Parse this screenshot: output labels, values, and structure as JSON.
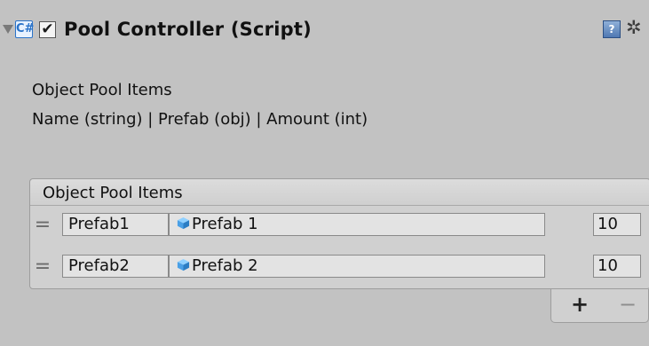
{
  "component": {
    "title": "Pool Controller (Script)",
    "script_icon": "C#",
    "enabled_checkmark": "✔",
    "help_icon_label": "?",
    "gear_icon_glyph": "✲"
  },
  "info": {
    "title": "Object Pool Items",
    "columns": "Name (string) | Prefab (obj) | Amount (int)"
  },
  "list": {
    "header": "Object Pool Items",
    "rows": [
      {
        "name": "Prefab1",
        "prefab": "Prefab 1",
        "amount": "10"
      },
      {
        "name": "Prefab2",
        "prefab": "Prefab 2",
        "amount": "10"
      }
    ],
    "add_label": "+",
    "remove_label": "−",
    "drag_handle_glyph": "="
  },
  "colors": {
    "background": "#c2c2c2",
    "field_bg": "#e3e3e3",
    "prefab_icon": "#4aa0e6"
  }
}
